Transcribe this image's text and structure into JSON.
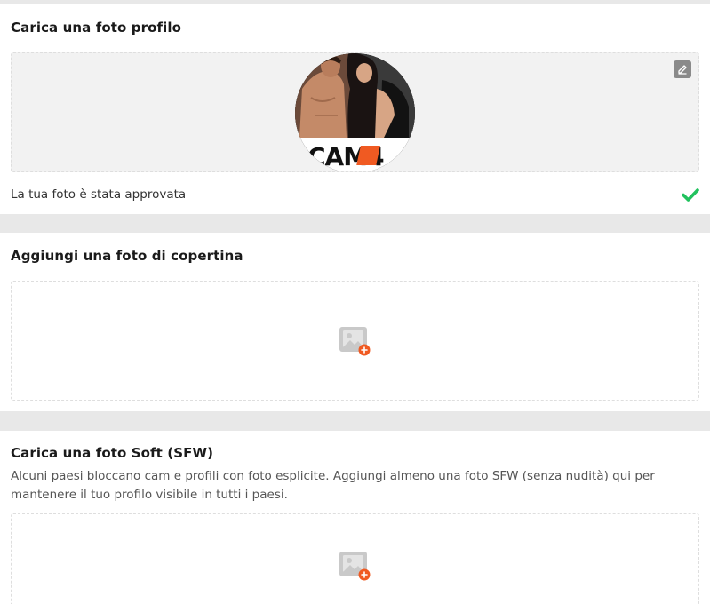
{
  "profile_section": {
    "title": "Carica una foto profilo",
    "avatar_logo": "CAM4",
    "edit_icon": "pencil-edit-icon",
    "status_text": "La tua foto è stata approvata",
    "status_icon": "checkmark-icon",
    "status_color": "#21c25e"
  },
  "cover_section": {
    "title": "Aggiungi una foto di copertina",
    "upload_icon": "add-image-icon"
  },
  "sfw_section": {
    "title": "Carica una foto Soft (SFW)",
    "description": "Alcuni paesi bloccano cam e profili con foto esplicite. Aggiungi almeno una foto SFW (senza nudità) qui per mantenere il tuo profilo visibile in tutti i paesi.",
    "upload_icon": "add-image-icon"
  },
  "colors": {
    "accent": "#f05a22",
    "background": "#e8e8e8",
    "card": "#ffffff"
  }
}
